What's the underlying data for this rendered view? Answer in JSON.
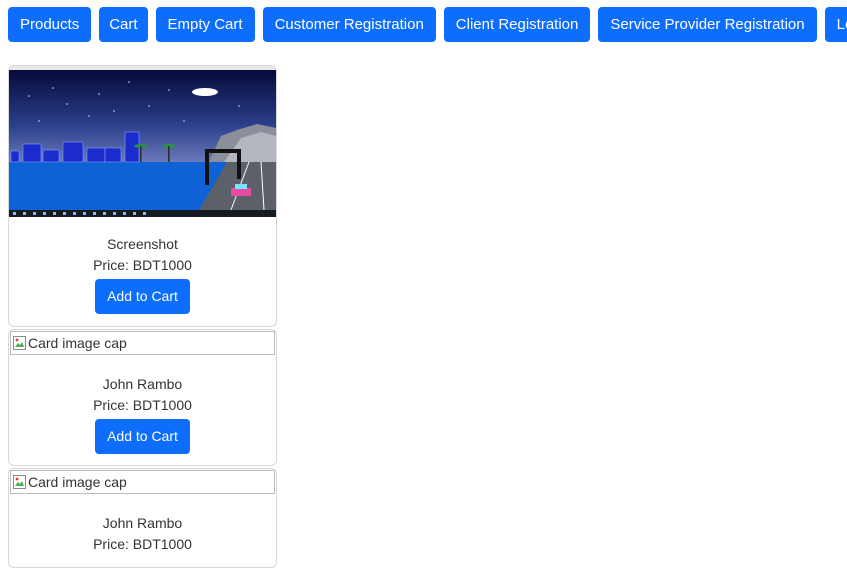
{
  "nav": {
    "products": "Products",
    "cart": "Cart",
    "empty_cart": "Empty Cart",
    "customer_registration": "Customer Registration",
    "client_registration": "Client Registration",
    "service_provider_registration": "Service Provider Registration",
    "login": "Login"
  },
  "products": [
    {
      "name": "Screenshot",
      "price": "Price: BDT1000",
      "button": "Add to Cart"
    },
    {
      "image_alt": "Card image cap",
      "name": "John Rambo",
      "price": "Price: BDT1000",
      "button": "Add to Cart"
    },
    {
      "image_alt": "Card image cap",
      "name": "John Rambo",
      "price": "Price: BDT1000"
    }
  ],
  "colors": {
    "primary": "#0d6efd",
    "border": "#d6d8db"
  }
}
